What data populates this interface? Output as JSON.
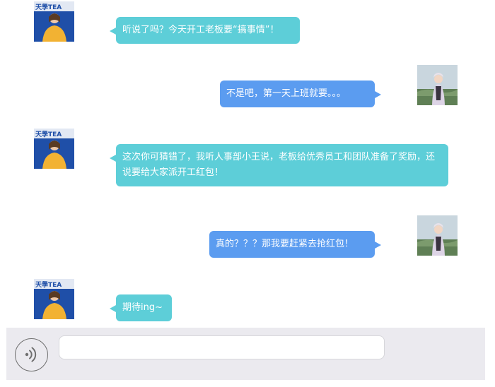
{
  "chat": {
    "messages": [
      {
        "sender": "colleague",
        "side": "left",
        "text": "听说了吗？今天开工老板要“搞事情”！"
      },
      {
        "sender": "me",
        "side": "right",
        "text": "不是吧，第一天上班就要。。。"
      },
      {
        "sender": "colleague",
        "side": "left",
        "text": "这次你可猜错了，我听人事部小王说，老板给优秀员工和团队准备了奖励，还说要给大家派开工红包！"
      },
      {
        "sender": "me",
        "side": "right",
        "text": "真的？？？那我要赶紧去抢红包！"
      },
      {
        "sender": "colleague",
        "side": "left",
        "text": "期待ing~"
      }
    ]
  },
  "avatars": {
    "colleague": {
      "icon": "woman-yellow-sweater-avatar",
      "banner_text": "天學TEA"
    },
    "me": {
      "icon": "woman-outdoor-photo-avatar"
    }
  },
  "input_bar": {
    "voice_icon": "voice-icon",
    "message_value": "",
    "message_placeholder": ""
  },
  "colors": {
    "left_bubble": "#5dced8",
    "right_bubble": "#5b9cf0",
    "input_bar_bg": "#ebeaef"
  }
}
